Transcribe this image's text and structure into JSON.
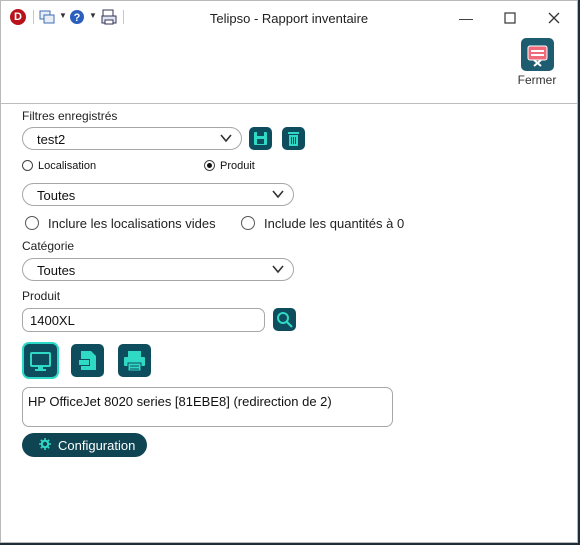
{
  "window": {
    "title": "Telipso - Rapport inventaire",
    "app_logo_letter": "D"
  },
  "ribbon": {
    "close_label": "Fermer"
  },
  "filters": {
    "saved_label": "Filtres enregistrés",
    "saved_value": "test2"
  },
  "mode": {
    "localisation_label": "Localisation",
    "produit_label": "Produit",
    "selected": "Produit"
  },
  "scope": {
    "value": "Toutes"
  },
  "options": {
    "include_empty_locations": "Inclure les localisations vides",
    "include_zero_quantities": "Include les quantités à 0"
  },
  "category": {
    "label": "Catégorie",
    "value": "Toutes"
  },
  "product": {
    "label": "Produit",
    "value": "1400XL"
  },
  "output": {
    "printer_text": "HP OfficeJet 8020 series [81EBE8] (redirection de 2)"
  },
  "config": {
    "label": "Configuration"
  },
  "colors": {
    "accent_dark": "#0d4d5e",
    "accent_highlight": "#2bd9c8",
    "logo_red": "#b8121b"
  }
}
